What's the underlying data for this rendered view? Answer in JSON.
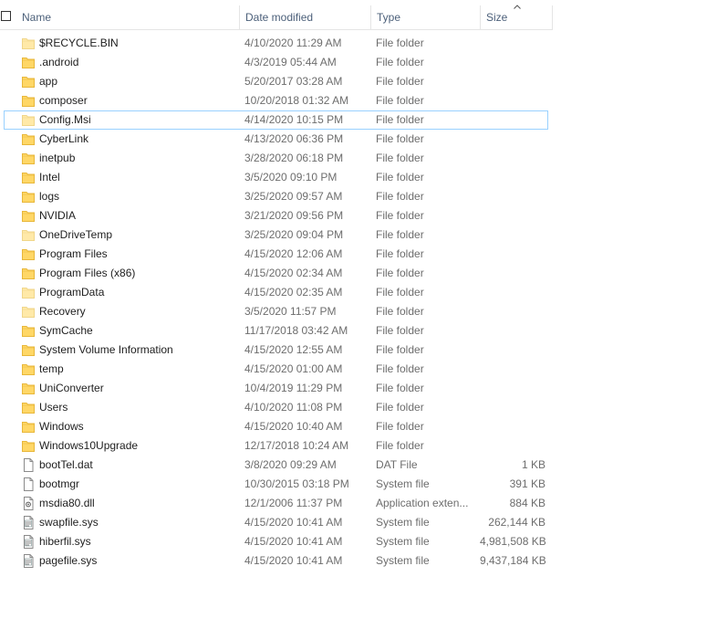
{
  "header": {
    "name": "Name",
    "date_modified": "Date modified",
    "type": "Type",
    "size": "Size"
  },
  "selected_row": 4,
  "colors": {
    "folder": "#ffd766",
    "folder_dim": "#ffe9a8",
    "selection_border": "#99d1ff"
  },
  "files": [
    {
      "name": "$RECYCLE.BIN",
      "date": "4/10/2020 11:29 AM",
      "type": "File folder",
      "size": "",
      "icon": "folder-icon",
      "dim": true
    },
    {
      "name": ".android",
      "date": "4/3/2019 05:44 AM",
      "type": "File folder",
      "size": "",
      "icon": "folder-icon",
      "dim": false
    },
    {
      "name": "app",
      "date": "5/20/2017 03:28 AM",
      "type": "File folder",
      "size": "",
      "icon": "folder-icon",
      "dim": false
    },
    {
      "name": "composer",
      "date": "10/20/2018 01:32 AM",
      "type": "File folder",
      "size": "",
      "icon": "folder-icon",
      "dim": false
    },
    {
      "name": "Config.Msi",
      "date": "4/14/2020 10:15 PM",
      "type": "File folder",
      "size": "",
      "icon": "folder-icon",
      "dim": true
    },
    {
      "name": "CyberLink",
      "date": "4/13/2020 06:36 PM",
      "type": "File folder",
      "size": "",
      "icon": "folder-icon",
      "dim": false
    },
    {
      "name": "inetpub",
      "date": "3/28/2020 06:18 PM",
      "type": "File folder",
      "size": "",
      "icon": "folder-icon",
      "dim": false
    },
    {
      "name": "Intel",
      "date": "3/5/2020 09:10 PM",
      "type": "File folder",
      "size": "",
      "icon": "folder-icon",
      "dim": false
    },
    {
      "name": "logs",
      "date": "3/25/2020 09:57 AM",
      "type": "File folder",
      "size": "",
      "icon": "folder-icon",
      "dim": false
    },
    {
      "name": "NVIDIA",
      "date": "3/21/2020 09:56 PM",
      "type": "File folder",
      "size": "",
      "icon": "folder-icon",
      "dim": false
    },
    {
      "name": "OneDriveTemp",
      "date": "3/25/2020 09:04 PM",
      "type": "File folder",
      "size": "",
      "icon": "folder-icon",
      "dim": true
    },
    {
      "name": "Program Files",
      "date": "4/15/2020 12:06 AM",
      "type": "File folder",
      "size": "",
      "icon": "folder-icon",
      "dim": false
    },
    {
      "name": "Program Files (x86)",
      "date": "4/15/2020 02:34 AM",
      "type": "File folder",
      "size": "",
      "icon": "folder-icon",
      "dim": false
    },
    {
      "name": "ProgramData",
      "date": "4/15/2020 02:35 AM",
      "type": "File folder",
      "size": "",
      "icon": "folder-icon",
      "dim": true
    },
    {
      "name": "Recovery",
      "date": "3/5/2020 11:57 PM",
      "type": "File folder",
      "size": "",
      "icon": "folder-icon",
      "dim": true
    },
    {
      "name": "SymCache",
      "date": "11/17/2018 03:42 AM",
      "type": "File folder",
      "size": "",
      "icon": "folder-icon",
      "dim": false
    },
    {
      "name": "System Volume Information",
      "date": "4/15/2020 12:55 AM",
      "type": "File folder",
      "size": "",
      "icon": "folder-icon",
      "dim": false
    },
    {
      "name": "temp",
      "date": "4/15/2020 01:00 AM",
      "type": "File folder",
      "size": "",
      "icon": "folder-icon",
      "dim": false
    },
    {
      "name": "UniConverter",
      "date": "10/4/2019 11:29 PM",
      "type": "File folder",
      "size": "",
      "icon": "folder-icon",
      "dim": false
    },
    {
      "name": "Users",
      "date": "4/10/2020 11:08 PM",
      "type": "File folder",
      "size": "",
      "icon": "folder-icon",
      "dim": false
    },
    {
      "name": "Windows",
      "date": "4/15/2020 10:40 AM",
      "type": "File folder",
      "size": "",
      "icon": "folder-icon",
      "dim": false
    },
    {
      "name": "Windows10Upgrade",
      "date": "12/17/2018 10:24 AM",
      "type": "File folder",
      "size": "",
      "icon": "folder-icon",
      "dim": false
    },
    {
      "name": "bootTel.dat",
      "date": "3/8/2020 09:29 AM",
      "type": "DAT File",
      "size": "1 KB",
      "icon": "file-icon",
      "dim": false
    },
    {
      "name": "bootmgr",
      "date": "10/30/2015 03:18 PM",
      "type": "System file",
      "size": "391 KB",
      "icon": "file-icon",
      "dim": false
    },
    {
      "name": "msdia80.dll",
      "date": "12/1/2006 11:37 PM",
      "type": "Application exten...",
      "size": "884 KB",
      "icon": "dll-file-icon",
      "dim": false
    },
    {
      "name": "swapfile.sys",
      "date": "4/15/2020 10:41 AM",
      "type": "System file",
      "size": "262,144 KB",
      "icon": "system-file-icon",
      "dim": false
    },
    {
      "name": "hiberfil.sys",
      "date": "4/15/2020 10:41 AM",
      "type": "System file",
      "size": "4,981,508 KB",
      "icon": "system-file-icon",
      "dim": false
    },
    {
      "name": "pagefile.sys",
      "date": "4/15/2020 10:41 AM",
      "type": "System file",
      "size": "9,437,184 KB",
      "icon": "system-file-icon",
      "dim": false
    }
  ]
}
